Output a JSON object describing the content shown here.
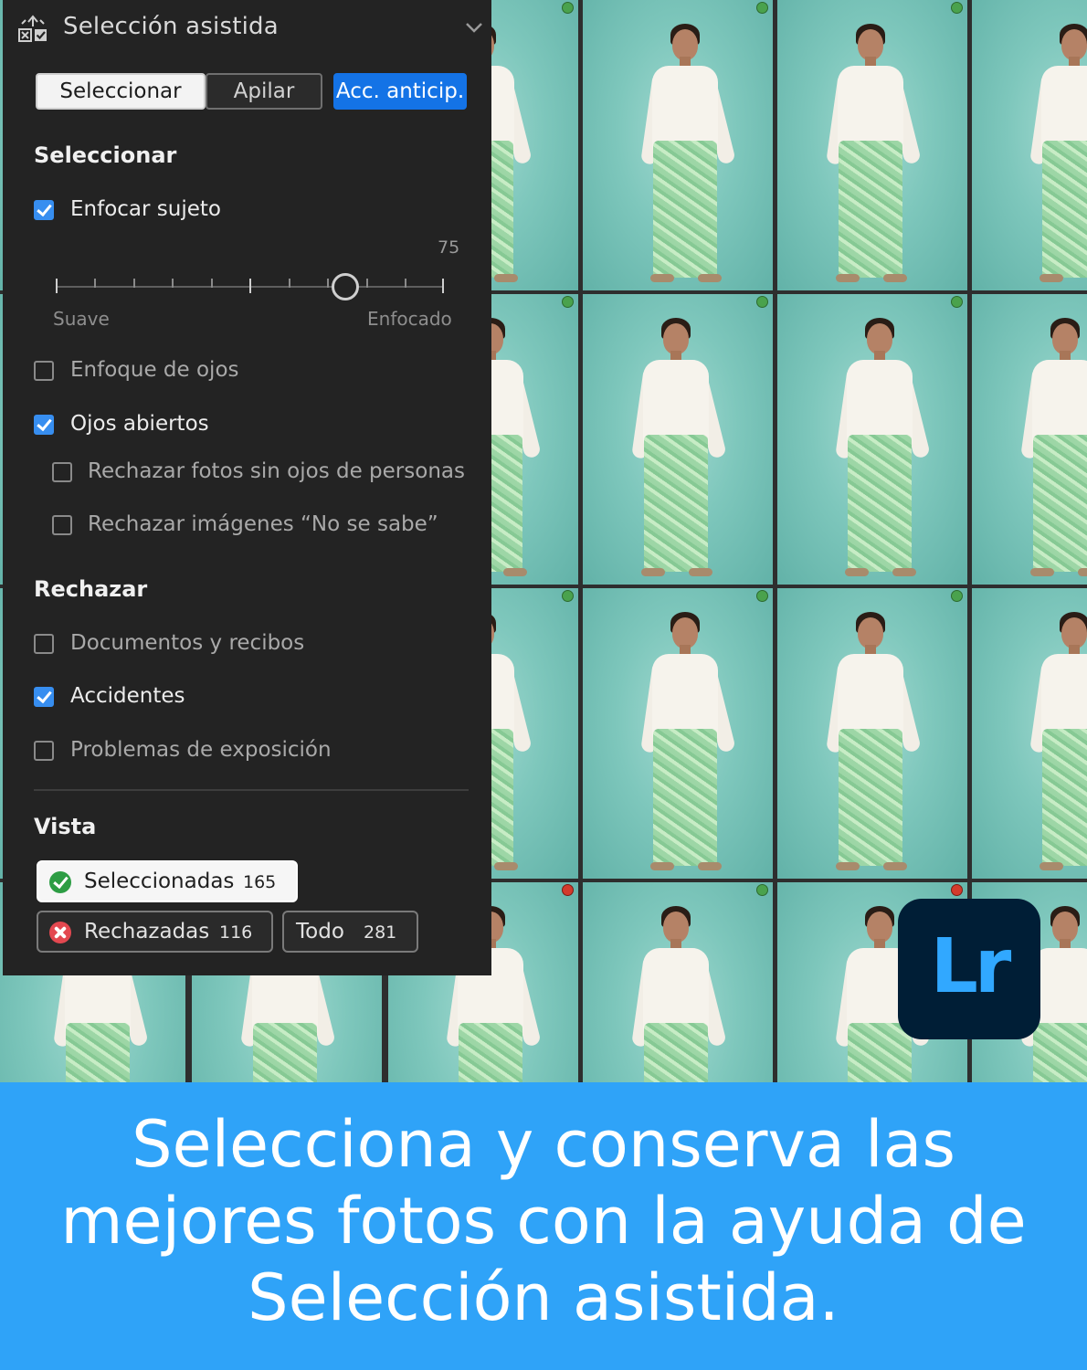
{
  "panel": {
    "title": "Selección asistida",
    "header_icon": "assisted-culling-icon",
    "collapse_icon": "chevron-down-icon",
    "tabs": [
      {
        "label": "Seleccionar",
        "active": true
      },
      {
        "label": "Apilar",
        "active": false
      },
      {
        "label": "Acc. anticip.",
        "accent": "#1473e6"
      }
    ],
    "select_section": {
      "title": "Seleccionar",
      "options": [
        {
          "label": "Enfocar sujeto",
          "checked": true
        },
        {
          "label": "Enfoque de ojos",
          "checked": false
        },
        {
          "label": "Ojos abiertos",
          "checked": true
        },
        {
          "label": "Rechazar fotos sin ojos de personas",
          "checked": false
        },
        {
          "label": "Rechazar imágenes “No se sabe”",
          "checked": false
        }
      ],
      "slider": {
        "value": "75",
        "min_label": "Suave",
        "max_label": "Enfocado",
        "level": 75
      }
    },
    "reject_section": {
      "title": "Rechazar",
      "options": [
        {
          "label": "Documentos y recibos",
          "checked": false
        },
        {
          "label": "Accidentes",
          "checked": true
        },
        {
          "label": "Problemas de exposición",
          "checked": false
        }
      ]
    },
    "view_section": {
      "title": "Vista",
      "selected": {
        "label": "Seleccionadas",
        "count": "165",
        "icon": "check-circle-icon"
      },
      "rejected": {
        "label": "Rechazadas",
        "count": "116",
        "icon": "x-circle-icon"
      },
      "all": {
        "label": "Todo",
        "count": "281"
      }
    }
  },
  "logo": {
    "text": "Lr",
    "bg": "#001e36",
    "fg": "#31a8ff"
  },
  "banner": {
    "text": "Selecciona y conserva las mejores fotos con la ayuda de Selección asistida.",
    "bg": "#2fa3f8"
  },
  "grid": {
    "photo_status": [
      "selected",
      "selected",
      "selected",
      "selected",
      "selected",
      "selected",
      "selected",
      "selected",
      "selected",
      "selected",
      "selected",
      "selected",
      "rejected",
      "selected",
      "rejected"
    ]
  }
}
